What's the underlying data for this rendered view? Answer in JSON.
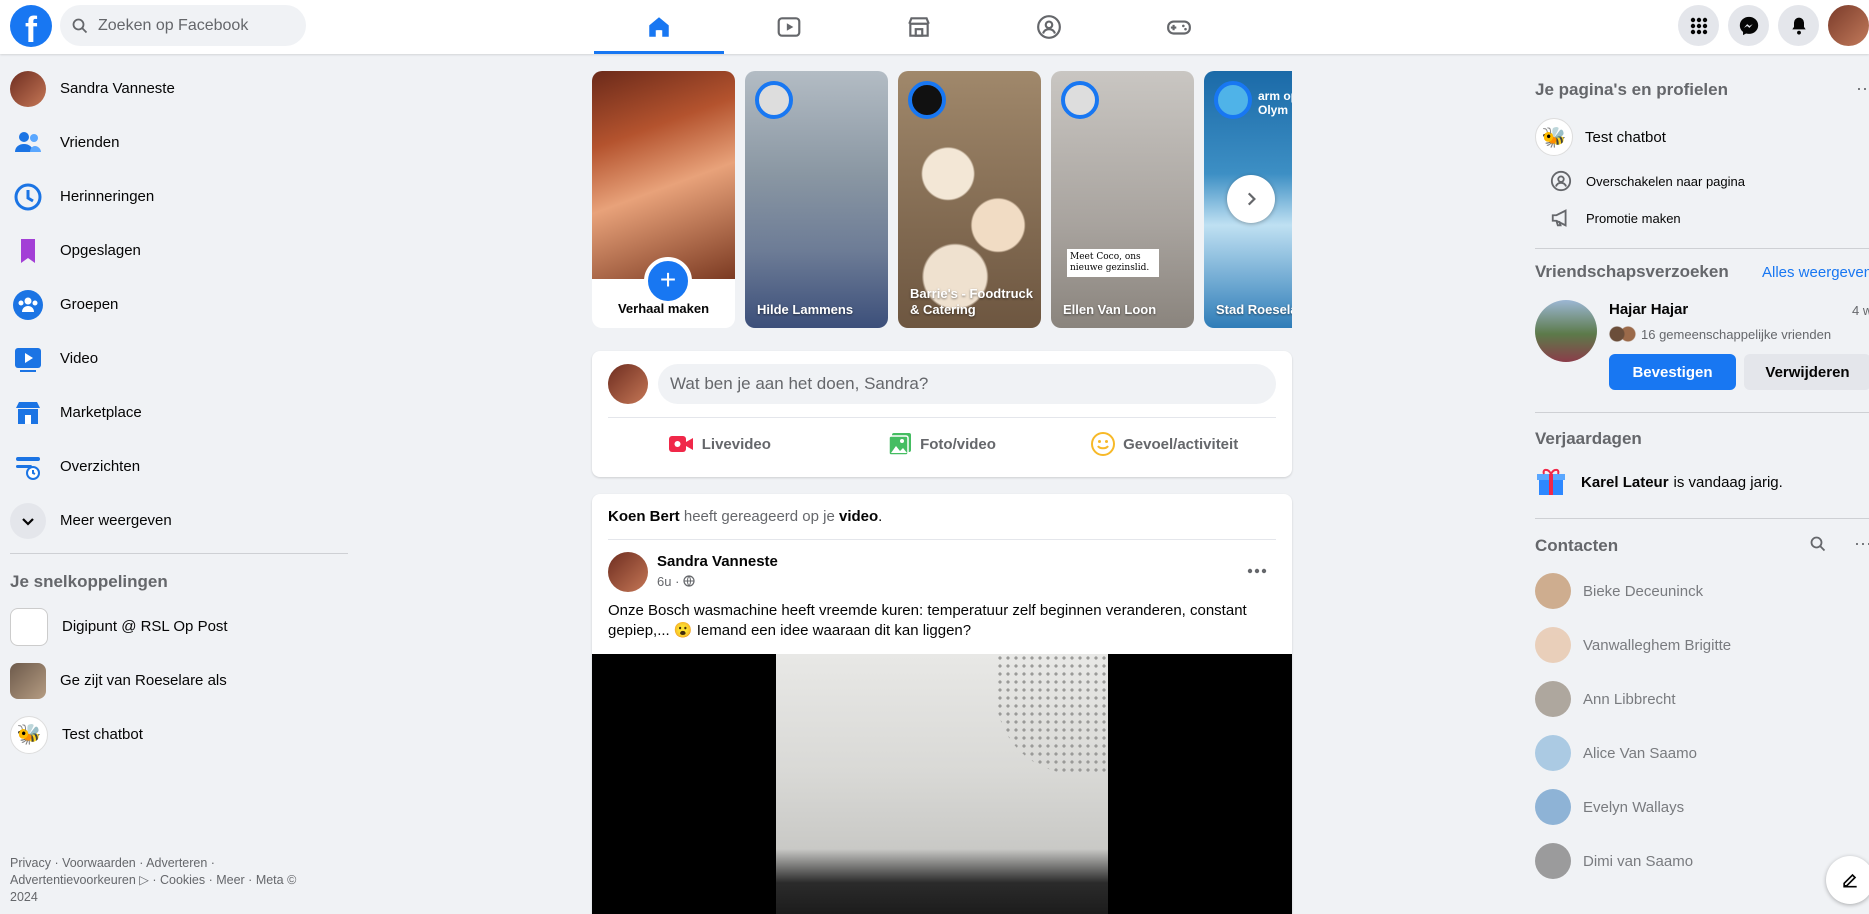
{
  "topbar": {
    "logo": "f",
    "search_placeholder": "Zoeken op Facebook",
    "tabs": [
      "home-icon",
      "video-icon",
      "marketplace-icon",
      "groups-icon",
      "gaming-icon"
    ]
  },
  "left_nav": {
    "items": [
      {
        "label": "Sandra Vanneste",
        "icon": "avatar"
      },
      {
        "label": "Vrienden",
        "icon": "friends-icon"
      },
      {
        "label": "Herinneringen",
        "icon": "memories-icon"
      },
      {
        "label": "Opgeslagen",
        "icon": "saved-icon"
      },
      {
        "label": "Groepen",
        "icon": "groups-icon"
      },
      {
        "label": "Video",
        "icon": "video-icon"
      },
      {
        "label": "Marketplace",
        "icon": "marketplace-icon"
      },
      {
        "label": "Overzichten",
        "icon": "feeds-icon"
      },
      {
        "label": "Meer weergeven",
        "icon": "chevron-down-icon"
      }
    ],
    "shortcuts_title": "Je snelkoppelingen",
    "shortcuts": [
      {
        "label": "Digipunt @ RSL Op Post"
      },
      {
        "label": "Ge zijt van Roeselare als"
      },
      {
        "label": "Test chatbot"
      }
    ],
    "footer": "Privacy · Voorwaarden · Adverteren · Advertentievoorkeuren ▷ · Cookies · Meer · Meta © 2024"
  },
  "stories": {
    "create_label": "Verhaal maken",
    "items": [
      {
        "name": "Hilde Lammens",
        "color": "#8a9aa8"
      },
      {
        "name": "Barrie's - Foodtruck & Catering",
        "color": "#9c7b58"
      },
      {
        "name": "Ellen Van Loon",
        "color": "#9d9a96"
      },
      {
        "name": "Stad Roeselare",
        "color": "#3d8fc4"
      }
    ],
    "story_text_ellen": "Meet Coco, ons nieuwe gezinslid.",
    "story_text_stad": "arm op Olym"
  },
  "composer": {
    "placeholder": "Wat ben je aan het doen, Sandra?",
    "actions": [
      {
        "label": "Livevideo",
        "icon": "live-video-icon",
        "color": "#f02849"
      },
      {
        "label": "Foto/video",
        "icon": "photo-icon",
        "color": "#45bd62"
      },
      {
        "label": "Gevoel/activiteit",
        "icon": "feeling-icon",
        "color": "#f7b928"
      }
    ]
  },
  "post": {
    "reactor": "Koen Bert",
    "reacted_text": "heeft gereageerd op je",
    "reacted_object": "video",
    "author": "Sandra Vanneste",
    "time": "6u ·",
    "text_before_emoji": "Onze Bosch wasmachine heeft vreemde kuren: temperatuur zelf beginnen veranderen, constant gepiep,...",
    "emoji": "😮",
    "text_after_emoji": "Iemand een idee waaraan dit kan liggen?"
  },
  "right": {
    "pages_title": "Je pagina's en profielen",
    "page_name": "Test chatbot",
    "page_actions": [
      "Overschakelen naar pagina",
      "Promotie maken"
    ],
    "requests_title": "Vriendschapsverzoeken",
    "requests_link": "Alles weergeven",
    "request": {
      "name": "Hajar Hajar",
      "time": "4 w",
      "mutual": "16 gemeenschappelijke vrienden",
      "confirm": "Bevestigen",
      "delete": "Verwijderen"
    },
    "birthdays_title": "Verjaardagen",
    "birthday_name": "Karel Lateur",
    "birthday_text": "is vandaag jarig.",
    "contacts_title": "Contacten",
    "contacts": [
      {
        "name": "Bieke Deceuninck",
        "color": "#c9a27e"
      },
      {
        "name": "Vanwalleghem Brigitte",
        "color": "#e8c9b0"
      },
      {
        "name": "Ann Libbrecht",
        "color": "#a39a8f"
      },
      {
        "name": "Alice Van Saamo",
        "color": "#9fc4e0"
      },
      {
        "name": "Evelyn Wallays",
        "color": "#7ea9d1"
      },
      {
        "name": "Dimi van Saamo",
        "color": "#8d8d8d"
      }
    ]
  }
}
